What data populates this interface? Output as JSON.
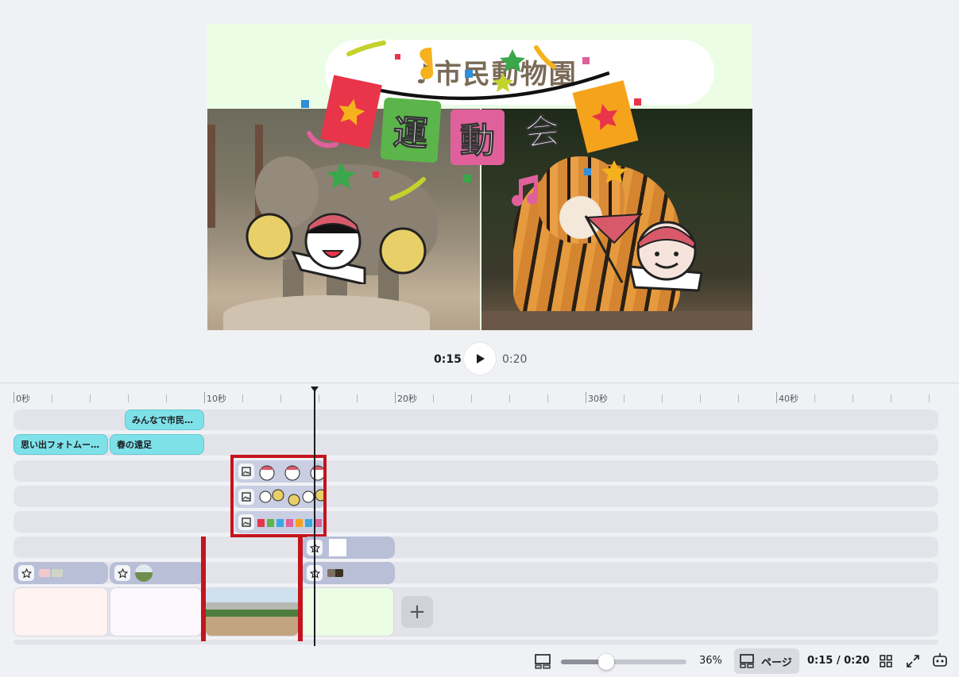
{
  "canvas": {
    "title_text": "♪市民動物園",
    "banner_chars": [
      "運",
      "動",
      "会"
    ],
    "banner_colors": [
      "#5bb54a",
      "#3aa7e0",
      "#e0609b"
    ],
    "photos": [
      "elephant",
      "tiger"
    ]
  },
  "playback": {
    "current_time": "0:15",
    "total_time": "0:20",
    "play_icon": "play-icon"
  },
  "ruler": {
    "labels": [
      "0秒",
      "10秒",
      "20秒",
      "30秒",
      "40秒"
    ]
  },
  "timeline": {
    "text_clips": [
      {
        "label": "みんなで市民…"
      },
      {
        "label": "思い出フォトムー…"
      },
      {
        "label": "春の遠足"
      }
    ],
    "icons": {
      "sticker": "sticker-icon",
      "image": "image-icon"
    },
    "add_page_label": "+"
  },
  "bottom_bar": {
    "zoom_percent": "36%",
    "zoom_fraction": 0.36,
    "page_button_label": "ページ",
    "time_readout": "0:15 / 0:20",
    "icons": [
      "layout-icon",
      "grid-icon",
      "fullscreen-icon",
      "assistant-icon"
    ]
  },
  "colors": {
    "text_clip": "#7fe1e8",
    "media_clip": "#b9bfd7",
    "selection": "#c4141d",
    "background": "#f0f1f5"
  }
}
